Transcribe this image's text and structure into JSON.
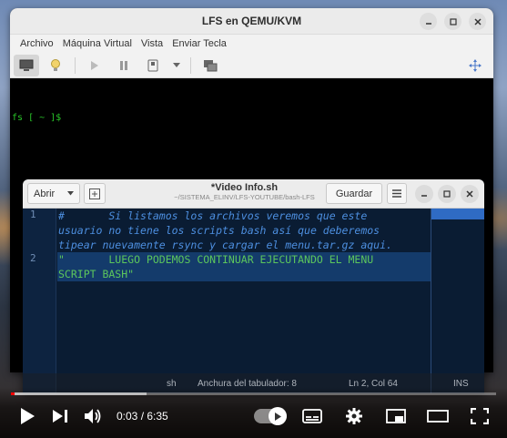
{
  "qemu": {
    "title": "LFS en QEMU/KVM",
    "menu": [
      "Archivo",
      "Máquina Virtual",
      "Vista",
      "Enviar Tecla"
    ],
    "toolbar_icons": [
      "monitor-icon",
      "lightbulb-icon",
      "play-icon",
      "pause-icon",
      "power-icon",
      "chevron-down-icon",
      "screens-icon",
      "fullscreen-move-icon"
    ],
    "console_prompt": "fs [ ~ ]$"
  },
  "gedit": {
    "open_label": "Abrir",
    "title": "*Video Info.sh",
    "path": "~/SISTEMA_ELINV/LFS-YOUTUBE/bash-LFS",
    "save_label": "Guardar",
    "lines": [
      {
        "number": "1",
        "segments": [
          "#       Si listamos los archivos veremos que este",
          "usuario no tiene los scripts bash así que deberemos",
          "tipear nuevamente rsync y cargar el menu.tar.gz aqui."
        ],
        "kind": "comment"
      },
      {
        "number": "2",
        "segments": [
          "\"       LUEGO PODEMOS CONTINUAR EJECUTANDO EL MENU",
          "SCRIPT BASH\""
        ],
        "kind": "string"
      }
    ],
    "status": {
      "language": "sh",
      "tab_width": "Anchura del tabulador: 8",
      "position": "Ln 2, Col 64",
      "mode": "INS"
    }
  },
  "player": {
    "current_time": "0:03",
    "separator": " / ",
    "duration": "6:35",
    "progress_fraction": 0.0076,
    "buffer_fraction": 0.28,
    "accent_color": "#ff0000"
  }
}
